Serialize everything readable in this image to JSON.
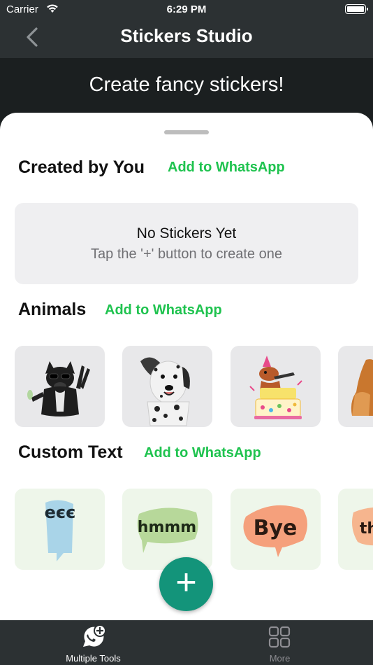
{
  "status": {
    "carrier": "Carrier",
    "time": "6:29 PM"
  },
  "nav": {
    "title": "Stickers Studio"
  },
  "banner": {
    "text": "Create fancy stickers!"
  },
  "sections": {
    "created": {
      "title": "Created by You",
      "add": "Add to WhatsApp"
    },
    "animals": {
      "title": "Animals",
      "add": "Add to WhatsApp"
    },
    "custom": {
      "title": "Custom Text",
      "add": "Add to WhatsApp"
    }
  },
  "empty": {
    "title": "No Stickers Yet",
    "subtitle": "Tap the '+' button to create one"
  },
  "stickers": {
    "custom_text": [
      "eєє",
      "hmmm",
      "Bye",
      "th"
    ]
  },
  "fab": {
    "icon": "plus-icon",
    "label": "+"
  },
  "tabbar": {
    "items": [
      {
        "label": "Multiple Tools",
        "icon": "sticker-plus-icon",
        "active": true
      },
      {
        "label": "More",
        "icon": "grid-icon",
        "active": false
      }
    ]
  },
  "colors": {
    "accent_green": "#1fc34f",
    "fab": "#13947a",
    "nav_bg": "#2c3133",
    "tab_active": "#ffffff",
    "tab_inactive": "#8e8e93"
  }
}
